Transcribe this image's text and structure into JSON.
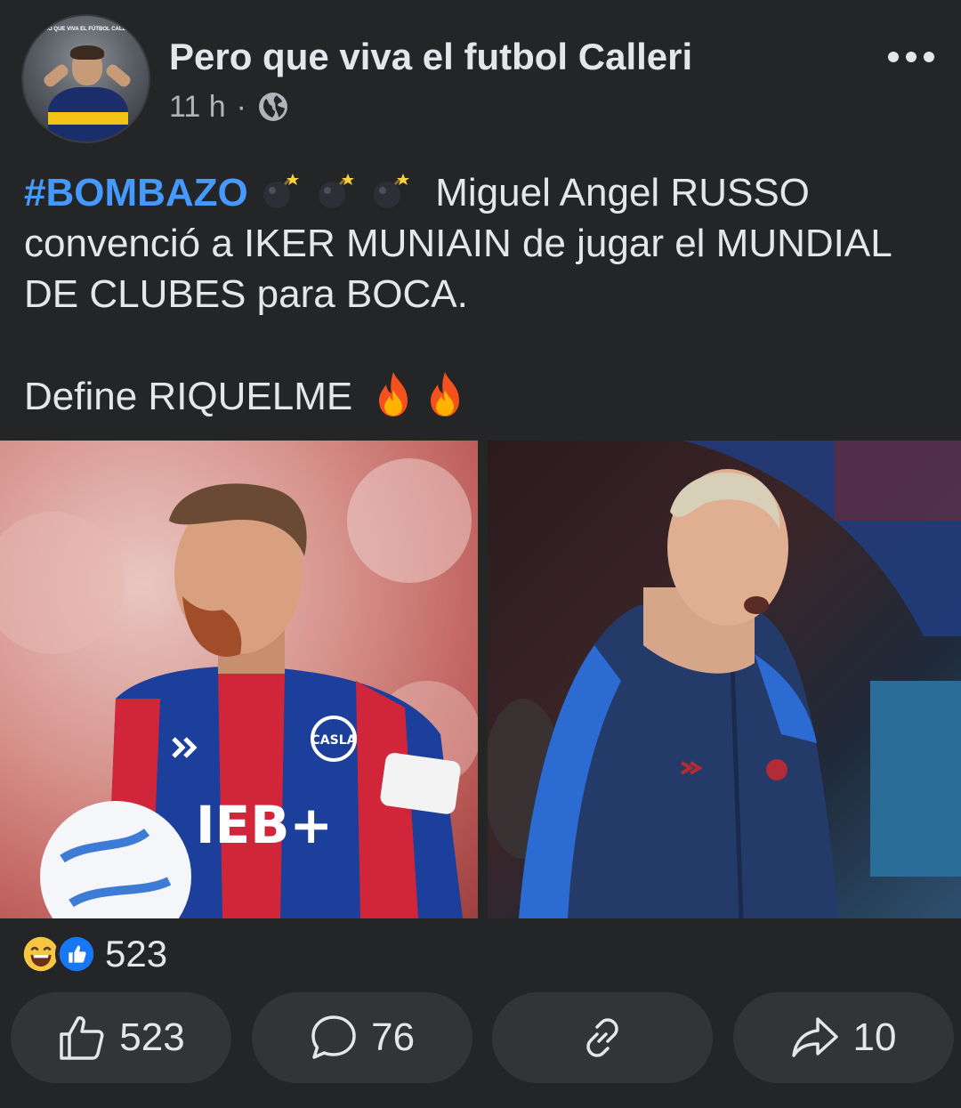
{
  "post": {
    "page_name": "Pero que viva el futbol Calleri",
    "time": "11 h",
    "separator": "·",
    "avatar_banner_text": "PERO QUE VIVA EL FÚTBOL CALLERI",
    "hashtag": "#BOMBAZO",
    "text_lead": "Miguel Angel RUSSO",
    "text_body": "convenció a IKER MUNIAIN de jugar el MUNDIAL DE CLUBES para BOCA.",
    "text_closing": "Define RIQUELME",
    "icons": {
      "avatar": "avatar",
      "privacy": "globe-icon",
      "more": "more-icon",
      "emoji_bomb": "bomb-emoji",
      "emoji_fire": "fire-emoji"
    },
    "photos": {
      "left_jersey_text": "IEB+",
      "left_crest_text": "CASLA"
    }
  },
  "reactions": {
    "icons": [
      "laughing-emoji-icon",
      "like-reaction-icon"
    ],
    "count": "523"
  },
  "actions": {
    "like_count": "523",
    "comment_count": "76",
    "share_count": "10"
  },
  "colors": {
    "background": "#242526",
    "hashtag": "#4599ff",
    "button_bg": "#333435",
    "like_blue": "#1877f2"
  }
}
